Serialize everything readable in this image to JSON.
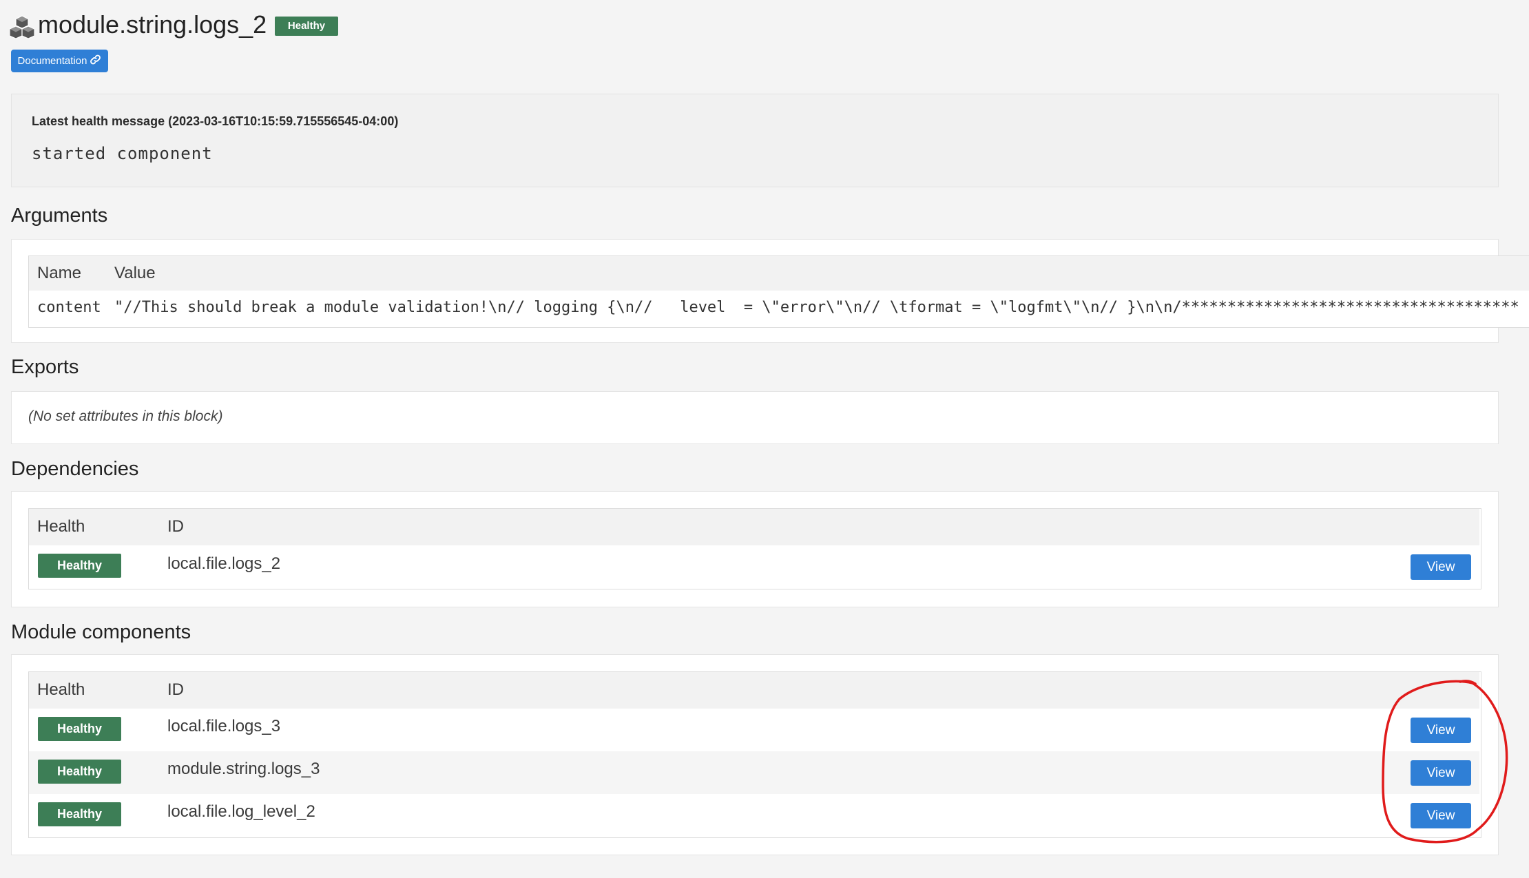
{
  "header": {
    "title": "module.string.logs_2",
    "status": "Healthy",
    "doc_label": "Documentation"
  },
  "health_message": {
    "label": "Latest health message (2023-03-16T10:15:59.715556545-04:00)",
    "message": "started component"
  },
  "arguments": {
    "title": "Arguments",
    "columns": [
      "Name",
      "Value"
    ],
    "rows": [
      {
        "name": "content",
        "value": "\"//This should break a module validation!\\n// logging {\\n//   level  = \\\"error\\\"\\n// \\tformat = \\\"logfmt\\\"\\n// }\\n\\n/*********************************************\\"
      }
    ]
  },
  "exports": {
    "title": "Exports",
    "empty_text": "(No set attributes in this block)"
  },
  "dependencies": {
    "title": "Dependencies",
    "columns": [
      "Health",
      "ID"
    ],
    "rows": [
      {
        "health": "Healthy",
        "id": "local.file.logs_2",
        "action": "View"
      }
    ]
  },
  "module_components": {
    "title": "Module components",
    "columns": [
      "Health",
      "ID"
    ],
    "rows": [
      {
        "health": "Healthy",
        "id": "local.file.logs_3",
        "action": "View"
      },
      {
        "health": "Healthy",
        "id": "module.string.logs_3",
        "action": "View"
      },
      {
        "health": "Healthy",
        "id": "local.file.log_level_2",
        "action": "View"
      }
    ]
  },
  "colors": {
    "healthy": "#3d7e56",
    "primary_button": "#2f7fd6",
    "annotation": "#e01b1b",
    "background": "#f4f4f4"
  },
  "icons": {
    "title_icon": "cubes-icon",
    "doc_icon": "link-icon"
  }
}
